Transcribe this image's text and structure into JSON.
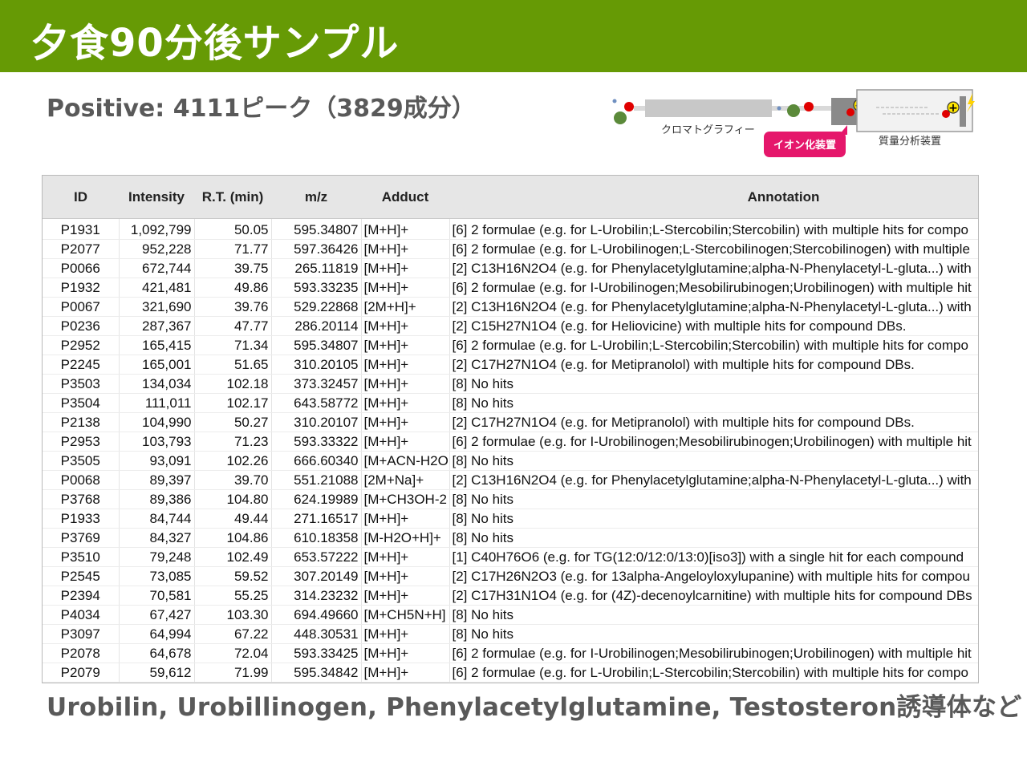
{
  "header": {
    "title": "夕食90分後サンプル"
  },
  "subtitle": "Positive:  4111ピーク（3829成分）",
  "diagram": {
    "chromatography_label": "クロマトグラフィー",
    "ionization_label": "イオン化装置",
    "ms_label": "質量分析装置",
    "plus_symbol": "+",
    "accent_color": "#e5176b",
    "ion_color": "#e00000",
    "molecule_color": "#5b8a3a",
    "column_color": "#c8c8c8"
  },
  "table": {
    "columns": [
      "ID",
      "Intensity",
      "R.T. (min)",
      "m/z",
      "Adduct",
      "Annotation"
    ],
    "rows": [
      [
        "P1931",
        "1,092,799",
        "50.05",
        "595.34807",
        "[M+H]+",
        "[6] 2 formulae (e.g. for L-Urobilin;L-Stercobilin;Stercobilin) with multiple hits for compo"
      ],
      [
        "P2077",
        "952,228",
        "71.77",
        "597.36426",
        "[M+H]+",
        "[6] 2 formulae (e.g. for L-Urobilinogen;L-Stercobilinogen;Stercobilinogen) with multiple"
      ],
      [
        "P0066",
        "672,744",
        "39.75",
        "265.11819",
        "[M+H]+",
        "[2] C13H16N2O4 (e.g. for Phenylacetylglutamine;alpha-N-Phenylacetyl-L-gluta...) with"
      ],
      [
        "P1932",
        "421,481",
        "49.86",
        "593.33235",
        "[M+H]+",
        "[6] 2 formulae (e.g. for I-Urobilinogen;Mesobilirubinogen;Urobilinogen) with multiple hit"
      ],
      [
        "P0067",
        "321,690",
        "39.76",
        "529.22868",
        "[2M+H]+",
        "[2] C13H16N2O4 (e.g. for Phenylacetylglutamine;alpha-N-Phenylacetyl-L-gluta...) with"
      ],
      [
        "P0236",
        "287,367",
        "47.77",
        "286.20114",
        "[M+H]+",
        "[2] C15H27N1O4 (e.g. for Heliovicine) with multiple hits for compound DBs."
      ],
      [
        "P2952",
        "165,415",
        "71.34",
        "595.34807",
        "[M+H]+",
        "[6] 2 formulae (e.g. for L-Urobilin;L-Stercobilin;Stercobilin) with multiple hits for compo"
      ],
      [
        "P2245",
        "165,001",
        "51.65",
        "310.20105",
        "[M+H]+",
        "[2] C17H27N1O4 (e.g. for Metipranolol) with multiple hits for compound DBs."
      ],
      [
        "P3503",
        "134,034",
        "102.18",
        "373.32457",
        "[M+H]+",
        "[8] No hits"
      ],
      [
        "P3504",
        "111,011",
        "102.17",
        "643.58772",
        "[M+H]+",
        "[8] No hits"
      ],
      [
        "P2138",
        "104,990",
        "50.27",
        "310.20107",
        "[M+H]+",
        "[2] C17H27N1O4 (e.g. for Metipranolol) with multiple hits for compound DBs."
      ],
      [
        "P2953",
        "103,793",
        "71.23",
        "593.33322",
        "[M+H]+",
        "[6] 2 formulae (e.g. for I-Urobilinogen;Mesobilirubinogen;Urobilinogen) with multiple hit"
      ],
      [
        "P3505",
        "93,091",
        "102.26",
        "666.60340",
        "[M+ACN-H2O",
        "[8] No hits"
      ],
      [
        "P0068",
        "89,397",
        "39.70",
        "551.21088",
        "[2M+Na]+",
        "[2] C13H16N2O4 (e.g. for Phenylacetylglutamine;alpha-N-Phenylacetyl-L-gluta...) with"
      ],
      [
        "P3768",
        "89,386",
        "104.80",
        "624.19989",
        "[M+CH3OH-2",
        "[8] No hits"
      ],
      [
        "P1933",
        "84,744",
        "49.44",
        "271.16517",
        "[M+H]+",
        "[8] No hits"
      ],
      [
        "P3769",
        "84,327",
        "104.86",
        "610.18358",
        "[M-H2O+H]+",
        "[8] No hits"
      ],
      [
        "P3510",
        "79,248",
        "102.49",
        "653.57222",
        "[M+H]+",
        "[1] C40H76O6 (e.g. for TG(12:0/12:0/13:0)[iso3]) with a single hit for each compound"
      ],
      [
        "P2545",
        "73,085",
        "59.52",
        "307.20149",
        "[M+H]+",
        "[2] C17H26N2O3 (e.g. for 13alpha-Angeloyloxylupanine) with multiple hits for compou"
      ],
      [
        "P2394",
        "70,581",
        "55.25",
        "314.23232",
        "[M+H]+",
        "[2] C17H31N1O4 (e.g. for (4Z)-decenoylcarnitine) with multiple hits for compound DBs"
      ],
      [
        "P4034",
        "67,427",
        "103.30",
        "694.49660",
        "[M+CH5N+H]",
        "[8] No hits"
      ],
      [
        "P3097",
        "64,994",
        "67.22",
        "448.30531",
        "[M+H]+",
        "[8] No hits"
      ],
      [
        "P2078",
        "64,678",
        "72.04",
        "593.33425",
        "[M+H]+",
        "[6] 2 formulae (e.g. for I-Urobilinogen;Mesobilirubinogen;Urobilinogen) with multiple hit"
      ],
      [
        "P2079",
        "59,612",
        "71.99",
        "595.34842",
        "[M+H]+",
        "[6] 2 formulae (e.g. for L-Urobilin;L-Stercobilin;Stercobilin) with multiple hits for compo"
      ]
    ]
  },
  "footer": {
    "text": "Urobilin, Urobillinogen, Phenylacetylglutamine, Testosteron誘導体など"
  }
}
